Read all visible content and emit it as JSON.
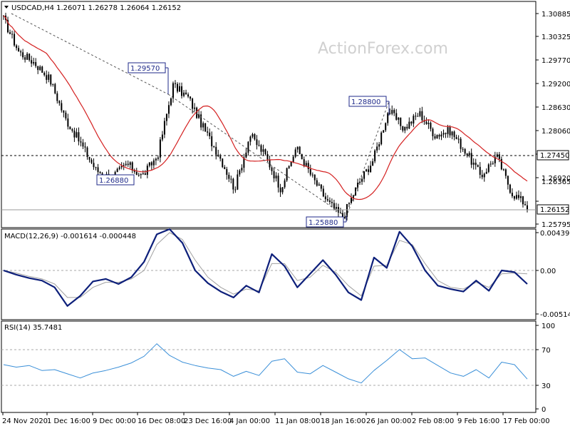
{
  "header": {
    "symbol_line": "USDCAD,H4  1.26071 1.26278 1.26064 1.26152",
    "watermark": "ActionForex.com"
  },
  "colors": {
    "candle": "#000000",
    "ma": "#d42020",
    "macd": "#0d1f7a",
    "signal": "#a0a0a0",
    "rsi": "#3a8fd8",
    "trend": "#555555",
    "tag_text": "#1f2a8a"
  },
  "x_axis": {
    "labels": [
      "24 Nov 2020",
      "1 Dec 16:00",
      "9 Dec 00:00",
      "16 Dec 08:00",
      "23 Dec 16:00",
      "4 Jan 00:00",
      "11 Jan 08:00",
      "18 Jan 16:00",
      "26 Jan 00:00",
      "2 Feb 08:00",
      "9 Feb 16:00",
      "17 Feb 00:00"
    ]
  },
  "price_panel": {
    "y_ticks": [
      "1.30885",
      "1.30325",
      "1.29770",
      "1.29200",
      "1.28630",
      "1.28060",
      "1.27490",
      "1.26920",
      "1.26365",
      "1.25795"
    ],
    "hline_label": "1.27450",
    "last_label": "1.26152",
    "annotations": [
      "1.29570",
      "1.26880",
      "1.28800",
      "1.25880"
    ]
  },
  "macd_panel": {
    "header": "MACD(12,26,9) -0.001614 -0.000448",
    "y_ticks": [
      "0.004396",
      "0.00",
      "-0.005144"
    ]
  },
  "rsi_panel": {
    "header": "RSI(14) 35.7481",
    "y_ticks": [
      "100",
      "70",
      "30",
      "0"
    ]
  },
  "chart_data": [
    {
      "type": "candlestick",
      "title": "USDCAD,H4",
      "categories": [
        "24 Nov 2020",
        "1 Dec 16:00",
        "9 Dec 00:00",
        "16 Dec 08:00",
        "23 Dec 16:00",
        "4 Jan 00:00",
        "11 Jan 08:00",
        "18 Jan 16:00",
        "26 Jan 00:00",
        "2 Feb 08:00",
        "9 Feb 16:00",
        "17 Feb 00:00"
      ],
      "close_path": [
        1.3075,
        1.2995,
        1.297,
        1.293,
        1.2835,
        1.2775,
        1.271,
        1.269,
        1.2725,
        1.2695,
        1.2745,
        1.2915,
        1.2885,
        1.281,
        1.2745,
        1.2665,
        1.2795,
        1.2745,
        1.2665,
        1.2765,
        1.2695,
        1.2635,
        1.2595,
        1.2675,
        1.2735,
        1.2855,
        1.281,
        1.2848,
        1.2795,
        1.2805,
        1.2755,
        1.2695,
        1.2745,
        1.2655,
        1.2625
      ],
      "ohlc_last": [
        1.26071,
        1.26278,
        1.26064,
        1.26152
      ],
      "horizontal_level": 1.2745,
      "labels": [
        1.2957,
        1.2688,
        1.288,
        1.2588
      ],
      "ylim": [
        1.2575,
        1.3095
      ]
    },
    {
      "type": "line",
      "title": "MACD(12,26,9)",
      "series": [
        {
          "name": "MACD",
          "values": [
            0.0,
            -0.0005,
            -0.0009,
            -0.0012,
            -0.002,
            -0.0042,
            -0.003,
            -0.0013,
            -0.001,
            -0.0016,
            -0.0008,
            0.001,
            0.0042,
            0.0048,
            0.0032,
            0.0,
            -0.0015,
            -0.0025,
            -0.0032,
            -0.0018,
            -0.0026,
            0.0019,
            0.0005,
            -0.002,
            -0.0004,
            0.0012,
            -0.0005,
            -0.0026,
            -0.0035,
            0.0015,
            0.0003,
            0.0045,
            0.0028,
            0.0,
            -0.0018,
            -0.0022,
            -0.0025,
            -0.0012,
            -0.0024,
            0.0,
            -0.0002,
            -0.0016
          ]
        },
        {
          "name": "Signal",
          "values": [
            0.0,
            -0.0003,
            -0.0007,
            -0.001,
            -0.0016,
            -0.0032,
            -0.0032,
            -0.002,
            -0.0014,
            -0.0014,
            -0.001,
            0.0,
            0.003,
            0.0044,
            0.0036,
            0.0012,
            -0.0008,
            -0.002,
            -0.0028,
            -0.0022,
            -0.0024,
            0.0008,
            0.0008,
            -0.0012,
            -0.0008,
            0.0006,
            -0.0002,
            -0.0018,
            -0.003,
            0.0005,
            0.0006,
            0.0035,
            0.003,
            0.0008,
            -0.0012,
            -0.002,
            -0.0022,
            -0.0014,
            -0.002,
            -0.0004,
            -0.0003,
            -0.0004
          ]
        }
      ],
      "last_values": [
        -0.001614,
        -0.000448
      ],
      "ylim": [
        -0.005144,
        0.004396
      ]
    },
    {
      "type": "line",
      "title": "RSI(14)",
      "series": [
        {
          "name": "RSI(14)",
          "values": [
            53,
            50,
            52,
            46,
            47,
            42,
            37,
            43,
            46,
            50,
            55,
            63,
            78,
            64,
            56,
            52,
            49,
            47,
            39,
            45,
            40,
            57,
            60,
            44,
            42,
            52,
            44,
            36,
            31,
            46,
            58,
            71,
            60,
            61,
            52,
            43,
            39,
            47,
            37,
            56,
            53,
            35.7481
          ]
        }
      ],
      "reference_lines": [
        70,
        30
      ],
      "ylim": [
        0,
        100
      ]
    }
  ]
}
